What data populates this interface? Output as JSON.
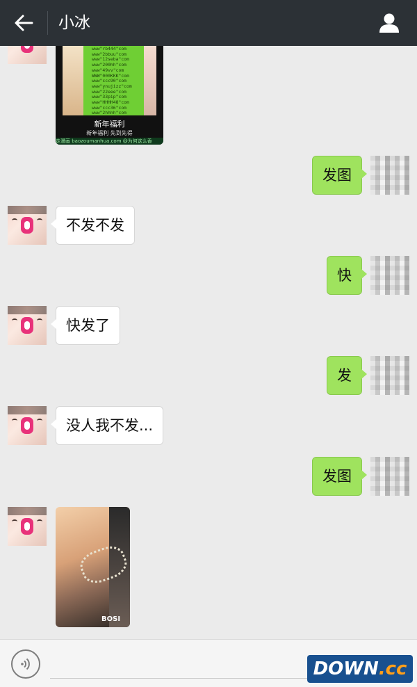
{
  "header": {
    "title": "小冰"
  },
  "poster": {
    "sites": "www\"rb444\"com\nwww\"2bbuu\"com\nwww\"12seba\"com\nwww\"200hh\"com\nwww\"49vv\"com\nWWW\"000KKK\"com\nwww\"ccc90\"com\nwww\"ynujizz\"com\nwww\"22eee\"com\nwww\"33pip\"com\nwww\"HHHH48\"com\nwww\"ccc36\"com\nwww\"2hhhh\"com",
    "caption": "新年福利",
    "subcaption": "新年福利 先到先得",
    "footer": "走漫画 baozoumanhua.com @为何这么香"
  },
  "messages": [
    {
      "side": "right",
      "text": "发图"
    },
    {
      "side": "left",
      "text": "不发不发"
    },
    {
      "side": "right",
      "text": "快"
    },
    {
      "side": "left",
      "text": "快发了"
    },
    {
      "side": "right",
      "text": "发"
    },
    {
      "side": "left",
      "text": "没人我不发..."
    },
    {
      "side": "right",
      "text": "发图"
    }
  ],
  "photo": {
    "brand": "BOSI"
  },
  "watermark": {
    "left": "DOWN",
    "right": ".cc"
  },
  "icons": {
    "back": "back-arrow-icon",
    "profile": "person-icon",
    "voice": "voice-icon"
  },
  "colors": {
    "topbar": "#2c3136",
    "right_bubble": "#9fe35e",
    "left_bubble": "#ffffff",
    "background": "#ebebeb"
  }
}
